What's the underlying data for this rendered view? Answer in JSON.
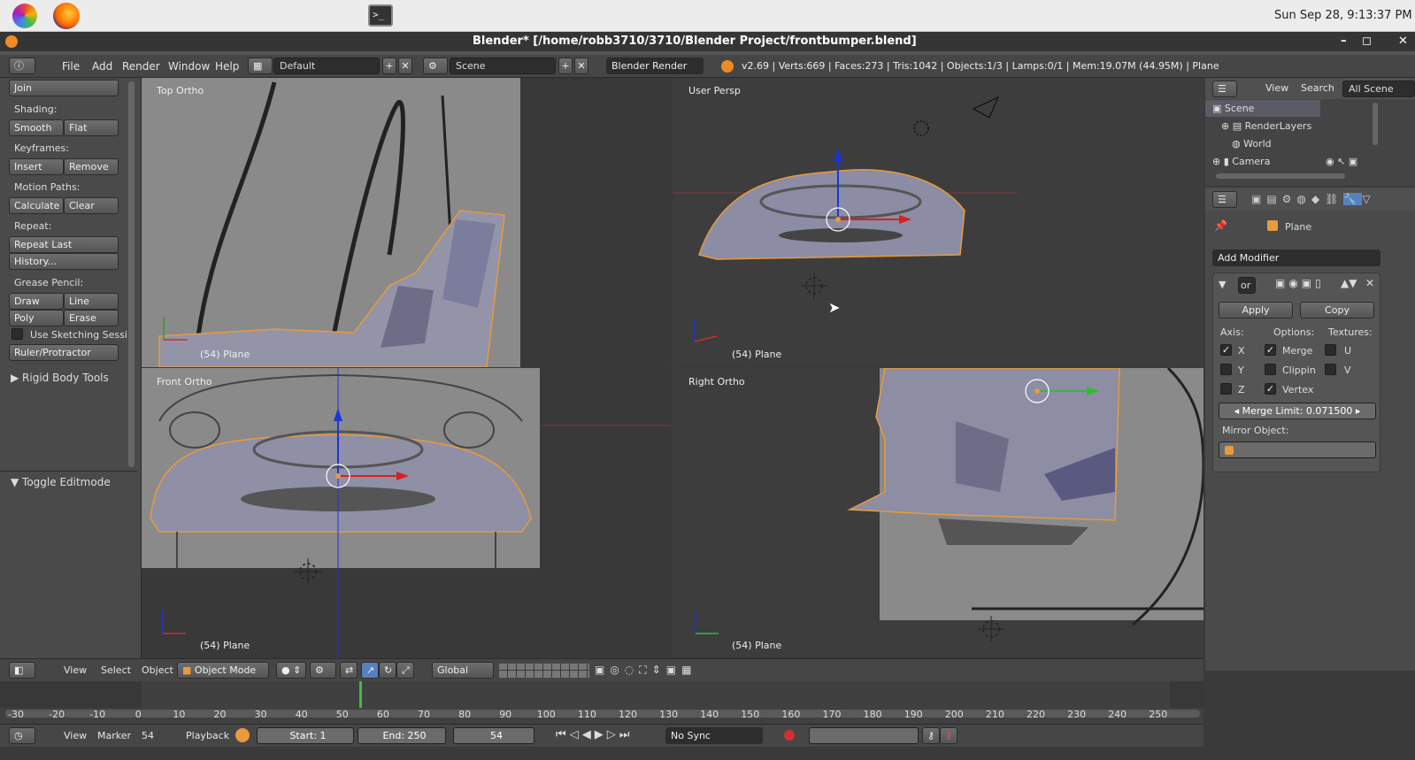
{
  "os": {
    "clock": "Sun Sep 28,  9:13:37 PM"
  },
  "window": {
    "title": "Blender* [/home/robb3710/3710/Blender Project/frontbumper.blend]",
    "controls": [
      "–",
      "◻",
      "✕"
    ]
  },
  "info": {
    "menus": [
      "File",
      "Add",
      "Render",
      "Window",
      "Help"
    ],
    "layout": "Default",
    "scene": "Scene",
    "engine": "Blender Render",
    "stats": "v2.69 | Verts:669 | Faces:273 | Tris:1042 | Objects:1/3 | Lamps:0/1 | Mem:19.07M (44.95M) | Plane"
  },
  "toolshelf": {
    "join": "Join",
    "shading_label": "Shading:",
    "smooth": "Smooth",
    "flat": "Flat",
    "keyframes_label": "Keyframes:",
    "insert": "Insert",
    "remove": "Remove",
    "motion_label": "Motion Paths:",
    "calculate": "Calculate",
    "clear": "Clear",
    "repeat_label": "Repeat:",
    "repeat_last": "Repeat Last",
    "history": "History...",
    "grease_label": "Grease Pencil:",
    "draw": "Draw",
    "line": "Line",
    "poly": "Poly",
    "erase": "Erase",
    "sketch": "Use Sketching Sessi",
    "ruler": "Ruler/Protractor",
    "rigid": "Rigid Body Tools",
    "toggle_edit": "Toggle Editmode"
  },
  "viewports": {
    "top": "Top Ortho",
    "persp": "User Persp",
    "front": "Front Ortho",
    "right": "Right Ortho",
    "obj": "(54) Plane"
  },
  "outliner": {
    "view": "View",
    "search": "Search",
    "all": "All Scene",
    "items": [
      "Scene",
      "RenderLayers",
      "World",
      "Camera"
    ]
  },
  "properties": {
    "object": "Plane",
    "add_modifier": "Add Modifier",
    "apply": "Apply",
    "copy": "Copy",
    "axis": "Axis:",
    "options": "Options:",
    "textures": "Textures:",
    "x": "X",
    "y": "Y",
    "z": "Z",
    "merge": "Merge",
    "clipping": "Clippin",
    "vertex": "Vertex",
    "u": "U",
    "v": "V",
    "merge_limit": "Merge Limit: 0.071500",
    "mirror_object": "Mirror Object:",
    "name_short": "or"
  },
  "v3dheader": {
    "view": "View",
    "select": "Select",
    "object": "Object",
    "mode": "Object Mode",
    "orientation": "Global"
  },
  "timeline": {
    "ticks": [
      "-30",
      "-20",
      "-10",
      "0",
      "10",
      "20",
      "30",
      "40",
      "50",
      "60",
      "70",
      "80",
      "90",
      "100",
      "110",
      "120",
      "130",
      "140",
      "150",
      "160",
      "170",
      "180",
      "190",
      "200",
      "210",
      "220",
      "230",
      "240",
      "250"
    ],
    "current_frame": 54
  },
  "tlheader": {
    "view": "View",
    "marker": "Marker",
    "frame": "54",
    "playback": "Playback",
    "start": "Start: 1",
    "end": "End: 250",
    "sync": "No Sync"
  }
}
